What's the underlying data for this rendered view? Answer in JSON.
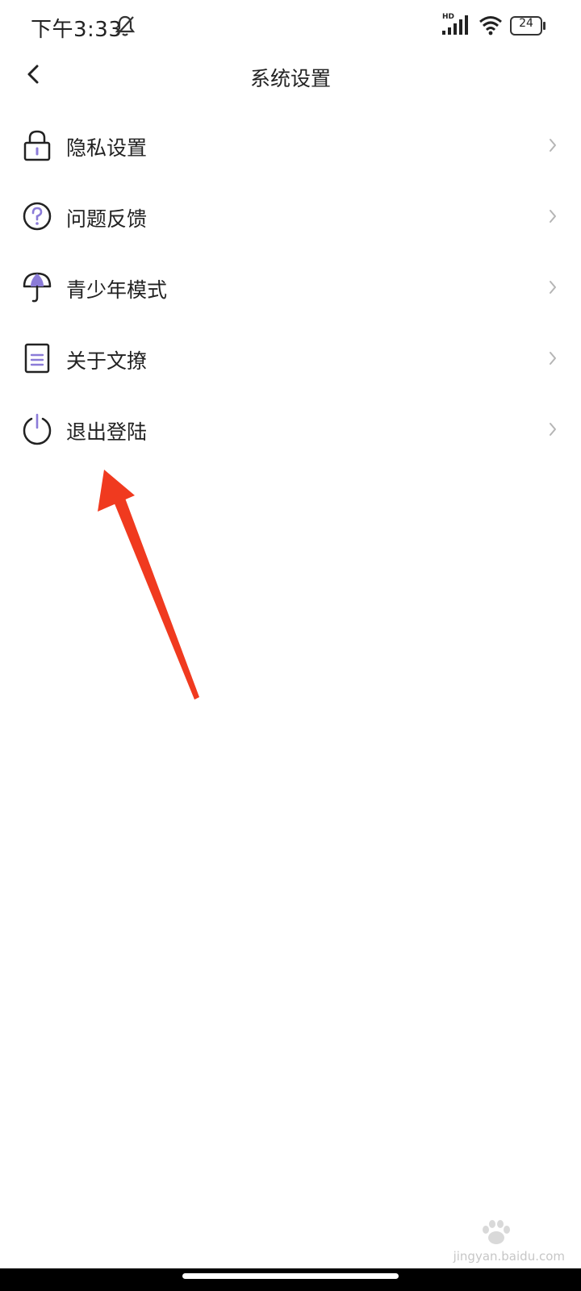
{
  "status_bar": {
    "time": "下午3:33",
    "network_label": "HD",
    "battery_level": "24",
    "icons": [
      "bell-muted-icon",
      "signal-icon",
      "wifi-icon",
      "battery-icon"
    ]
  },
  "header": {
    "title": "系统设置",
    "back_icon": "chevron-left-icon"
  },
  "settings": {
    "items": [
      {
        "label": "隐私设置",
        "icon": "lock-icon"
      },
      {
        "label": "问题反馈",
        "icon": "question-circle-icon"
      },
      {
        "label": "青少年模式",
        "icon": "umbrella-icon"
      },
      {
        "label": "关于文撩",
        "icon": "document-icon"
      },
      {
        "label": "退出登陆",
        "icon": "power-icon"
      }
    ]
  },
  "watermark": {
    "text": "jingyan.baidu.com"
  },
  "colors": {
    "accent": "#8b7bd8",
    "text": "#222222",
    "chevron": "#b5b5b5",
    "annotation_arrow": "#f03a1f"
  }
}
